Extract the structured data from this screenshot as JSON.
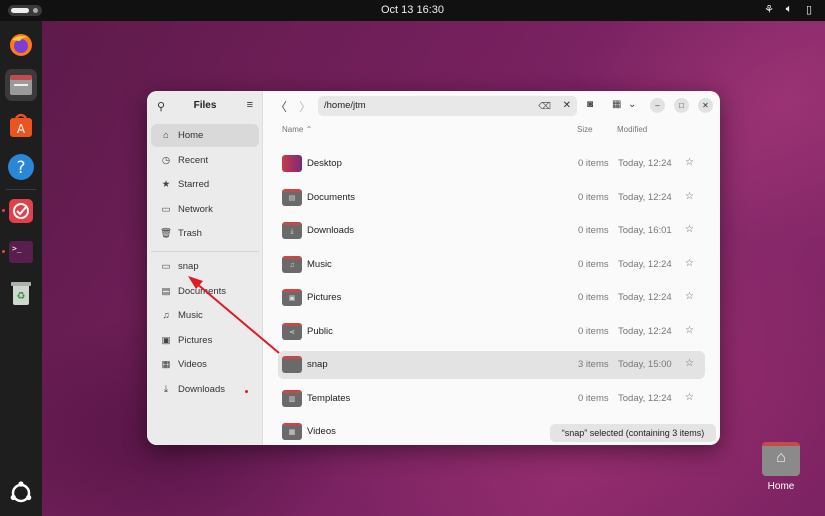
{
  "topbar": {
    "clock": "Oct 13  16:30"
  },
  "dock": {
    "apps": [
      "firefox-icon",
      "files-icon",
      "app-center-icon",
      "help-icon",
      "checkbox-app-icon",
      "terminal-icon",
      "trash-icon"
    ],
    "show_apps": "ubuntu-icon"
  },
  "window": {
    "sidebar": {
      "title": "Files",
      "items": [
        {
          "label": "Home",
          "icon": "home-icon"
        },
        {
          "label": "Recent",
          "icon": "clock-icon"
        },
        {
          "label": "Starred",
          "icon": "star-icon"
        },
        {
          "label": "Network",
          "icon": "network-icon"
        },
        {
          "label": "Trash",
          "icon": "trash-icon"
        }
      ],
      "bookmarks": [
        {
          "label": "snap",
          "icon": "folder-icon"
        },
        {
          "label": "Documents",
          "icon": "document-icon"
        },
        {
          "label": "Music",
          "icon": "music-icon"
        },
        {
          "label": "Pictures",
          "icon": "picture-icon"
        },
        {
          "label": "Videos",
          "icon": "video-icon"
        },
        {
          "label": "Downloads",
          "icon": "download-icon"
        }
      ]
    },
    "path": "/home/jtm",
    "columns": {
      "name": "Name",
      "size": "Size",
      "modified": "Modified"
    },
    "rows": [
      {
        "name": "Desktop",
        "size": "0 items",
        "modified": "Today, 12:24"
      },
      {
        "name": "Documents",
        "size": "0 items",
        "modified": "Today, 12:24"
      },
      {
        "name": "Downloads",
        "size": "0 items",
        "modified": "Today, 16:01"
      },
      {
        "name": "Music",
        "size": "0 items",
        "modified": "Today, 12:24"
      },
      {
        "name": "Pictures",
        "size": "0 items",
        "modified": "Today, 12:24"
      },
      {
        "name": "Public",
        "size": "0 items",
        "modified": "Today, 12:24"
      },
      {
        "name": "snap",
        "size": "3 items",
        "modified": "Today, 15:00"
      },
      {
        "name": "Templates",
        "size": "0 items",
        "modified": "Today, 12:24"
      },
      {
        "name": "Videos",
        "size": "",
        "modified": ""
      }
    ],
    "status": "“snap” selected  (containing 3 items)"
  },
  "desktop": {
    "home_label": "Home"
  },
  "colors": {
    "accent": "#e95420",
    "selection": "#e3e3e3",
    "arrow": "#e01b24"
  }
}
